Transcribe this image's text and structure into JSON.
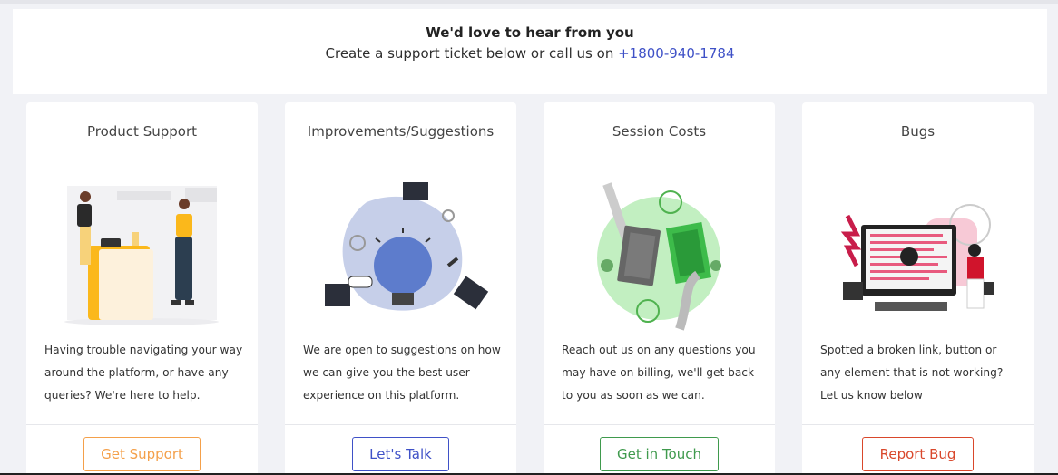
{
  "hero": {
    "title": "We'd love to hear from you",
    "subtitle": "Create a support ticket below or call us on",
    "phone": "+1800-940-1784"
  },
  "cards": [
    {
      "title": "Product Support",
      "description": "Having trouble navigating your way around the platform, or have any queries? We're here to help.",
      "button": "Get Support",
      "accent": "#f4a04a",
      "illustration": "support-desk-illustration"
    },
    {
      "title": "Improvements/Suggestions",
      "description": "We are open to suggestions on how we can give you the best user experience on this platform.",
      "button": "Let's Talk",
      "accent": "#3f51c7",
      "illustration": "lightbulb-ideas-illustration"
    },
    {
      "title": "Session Costs",
      "description": "Reach out us on any questions you may have on billing, we'll get back to you as soon as we can.",
      "button": "Get in Touch",
      "accent": "#3f9a4d",
      "illustration": "money-payment-illustration"
    },
    {
      "title": "Bugs",
      "description": "Spotted a broken link, button or any element that is not working? Let us know below",
      "button": "Report Bug",
      "accent": "#d9472b",
      "illustration": "bug-computer-illustration"
    }
  ]
}
